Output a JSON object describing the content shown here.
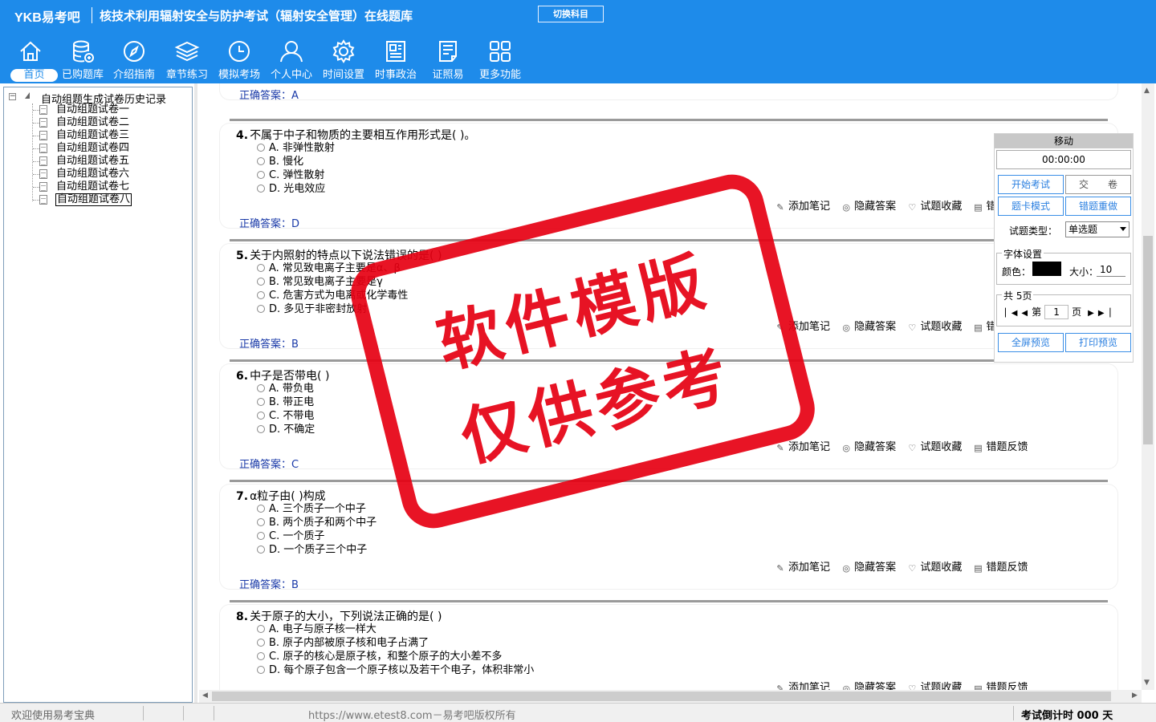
{
  "app": {
    "logo": "YKB易考吧",
    "title": "核技术利用辐射安全与防护考试（辐射安全管理）在线题库",
    "switch_subject": "切换科目"
  },
  "nav": [
    {
      "label": "首页",
      "icon": "home-icon"
    },
    {
      "label": "已购题库",
      "icon": "database-icon"
    },
    {
      "label": "介绍指南",
      "icon": "compass-icon"
    },
    {
      "label": "章节练习",
      "icon": "layers-icon"
    },
    {
      "label": "模拟考场",
      "icon": "clock-icon"
    },
    {
      "label": "个人中心",
      "icon": "user-icon"
    },
    {
      "label": "时间设置",
      "icon": "gear-icon"
    },
    {
      "label": "时事政治",
      "icon": "newspaper-icon"
    },
    {
      "label": "证照易",
      "icon": "certificate-icon"
    },
    {
      "label": "更多功能",
      "icon": "grid-icon"
    }
  ],
  "tree": {
    "root_toggle": "−",
    "root": "自动组题生成试卷历史记录",
    "items": [
      "自动组题试卷一",
      "自动组题试卷二",
      "自动组题试卷三",
      "自动组题试卷四",
      "自动组题试卷五",
      "自动组题试卷六",
      "自动组题试卷七",
      "自动组题试卷八"
    ]
  },
  "tools": {
    "note": "添加笔记",
    "hide": "隐藏答案",
    "fav": "试题收藏",
    "report": "错题反馈",
    "answer_prefix": "正确答案："
  },
  "prev_answer": "A",
  "questions": [
    {
      "num": "4.",
      "stem": "不属于中子和物质的主要相互作用形式是( )。",
      "options": [
        "A. 非弹性散射",
        "B. 慢化",
        "C. 弹性散射",
        "D. 光电效应"
      ],
      "answer": "D"
    },
    {
      "num": "5.",
      "stem": "关于内照射的特点以下说法错误的是( )",
      "options": [
        "A. 常见致电离子主要是α、β",
        "B. 常见致电离子主要是γ",
        "C. 危害方式为电离或化学毒性",
        "D. 多见于非密封放射"
      ],
      "answer": "B"
    },
    {
      "num": "6.",
      "stem": "中子是否带电( )",
      "options": [
        "A. 带负电",
        "B. 带正电",
        "C. 不带电",
        "D. 不确定"
      ],
      "answer": "C"
    },
    {
      "num": "7.",
      "stem": "α粒子由( )构成",
      "options": [
        "A. 三个质子一个中子",
        "B. 两个质子和两个中子",
        "C. 一个质子",
        "D. 一个质子三个中子"
      ],
      "answer": "B"
    },
    {
      "num": "8.",
      "stem": "关于原子的大小，下列说法正确的是( )",
      "options": [
        "A. 电子与原子核一样大",
        "B. 原子内部被原子核和电子占满了",
        "C. 原子的核心是原子核，和整个原子的大小差不多",
        "D. 每个原子包含一个原子核以及若干个电子，体积非常小"
      ],
      "answer": ""
    }
  ],
  "panel": {
    "move": "移动",
    "timer": "00:00:00",
    "start_exam": "开始考试",
    "submit": "交　　卷",
    "card_mode": "题卡模式",
    "redo_wrong": "错题重做",
    "type_label": "试题类型：",
    "type_value": "单选题",
    "font_title": "字体设置",
    "color_label": "颜色：",
    "size_label": "大小：",
    "size_value": "10",
    "pages_title": "共 5页",
    "page_prefix": "第",
    "page_value": "1",
    "page_suffix": "页",
    "fullscreen": "全屏预览",
    "print": "打印预览",
    "font_color": "#000000"
  },
  "stamp": {
    "line1": "软件模版",
    "line2": "仅供参考",
    "color": "#e60012"
  },
  "status": {
    "welcome": "欢迎使用易考宝典",
    "copyright": "https://www.etest8.com－易考吧版权所有",
    "countdown": "考试倒计时 000 天"
  }
}
